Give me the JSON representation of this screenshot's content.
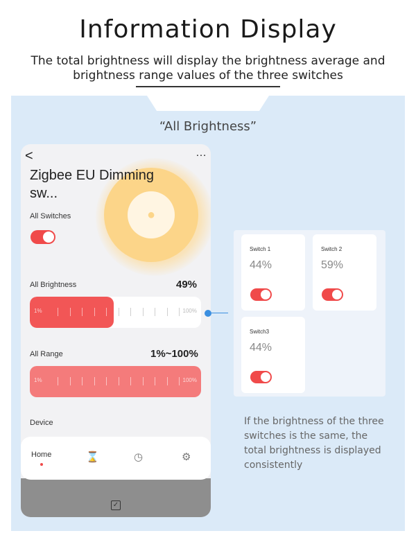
{
  "header": {
    "title": "Information Display",
    "subtitle": "The total brightness will display the brightness average and brightness range values of the three switches"
  },
  "section_label": "“All Brightness”",
  "app": {
    "back_glyph": "<",
    "more_glyph": "…",
    "device_name": "Zigbee EU Dimming sw...",
    "all_switches_label": "All Switches",
    "all_switches_on": true,
    "all_brightness_label": "All Brightness",
    "all_brightness_value": "49%",
    "all_brightness_fraction": 0.49,
    "slider_min": "1%",
    "slider_max": "100%",
    "all_range_label": "All Range",
    "all_range_value": "1%~100%",
    "device_label": "Device",
    "nav": {
      "home": "Home"
    }
  },
  "switches": [
    {
      "name": "Switch 1",
      "value": "44%",
      "on": true
    },
    {
      "name": "Switch 2",
      "value": "59%",
      "on": true
    },
    {
      "name": "Switch3",
      "value": "44%",
      "on": true
    }
  ],
  "note": "If the brightness of the three switches is the same, the total brightness is displayed consistently",
  "colors": {
    "accent": "#f04a4a",
    "panel": "#dbeaf8",
    "glow": "#fcd589",
    "connector": "#3b8fe0"
  },
  "icons": [
    "back-icon",
    "more-icon",
    "bulb-icon",
    "home-tab",
    "hourglass-icon",
    "clock-icon",
    "gear-icon",
    "checkbox-icon"
  ]
}
